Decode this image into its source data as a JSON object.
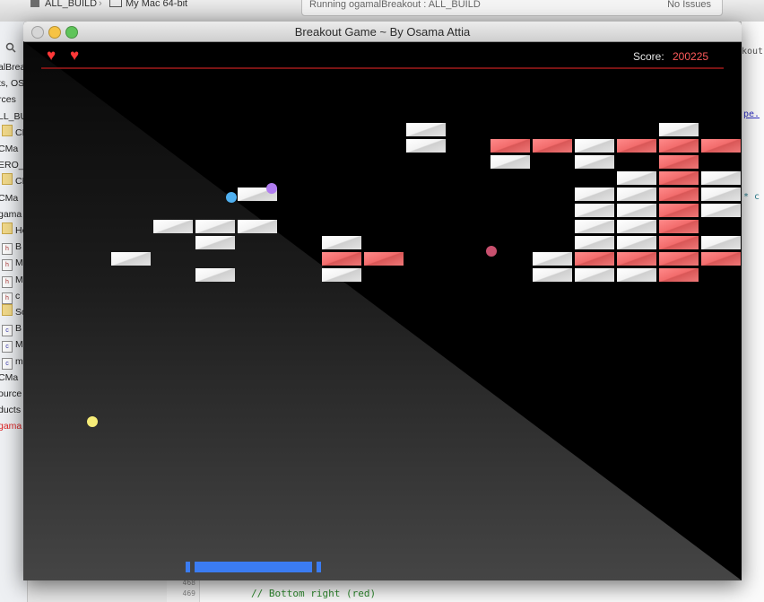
{
  "xcode": {
    "scheme": "ALL_BUILD",
    "destination": "My Mac 64-bit",
    "status": "Running ogamalBreakout : ALL_BUILD",
    "issues": "No Issues",
    "editor_fragments": [
      "koutz",
      "pe.",
      "* c"
    ],
    "navigator_rows": [
      {
        "text": "alBrea",
        "icon": ""
      },
      {
        "text": "ts, OS",
        "icon": ""
      },
      {
        "text": "rces",
        "icon": ""
      },
      {
        "text": "LL_BU",
        "icon": ""
      },
      {
        "text": "CMa",
        "icon": "folder"
      },
      {
        "text": "CMa",
        "icon": ""
      },
      {
        "text": "ERO_",
        "icon": ""
      },
      {
        "text": "CMa",
        "icon": "folder"
      },
      {
        "text": "CMa",
        "icon": ""
      },
      {
        "text": "gama",
        "icon": ""
      },
      {
        "text": "Hea",
        "icon": "folder"
      },
      {
        "text": "B",
        "icon": "h"
      },
      {
        "text": "M",
        "icon": "h"
      },
      {
        "text": "M",
        "icon": "h"
      },
      {
        "text": "c",
        "icon": "h"
      },
      {
        "text": "Sou",
        "icon": "folder"
      },
      {
        "text": "B",
        "icon": "src"
      },
      {
        "text": "M",
        "icon": "src"
      },
      {
        "text": "m",
        "icon": "src"
      },
      {
        "text": "CMa",
        "icon": ""
      },
      {
        "text": "ource",
        "icon": ""
      },
      {
        "text": "ducts",
        "icon": ""
      },
      {
        "text": "gama",
        "icon": "",
        "color": "#d22"
      }
    ],
    "line_numbers": [
      "468",
      "469"
    ],
    "code_comment": "// Bottom right (red)"
  },
  "window": {
    "title": "Breakout Game ~ By Osama Attia"
  },
  "hud": {
    "lives": 2,
    "heart_glyph": "♥",
    "score_label": "Score:",
    "score_value": "200225",
    "accent_color": "#ff3838"
  },
  "bricks": {
    "grid_origin": "top-left, 47px columns, 18px rows",
    "white": [
      [
        8,
        0
      ],
      [
        14,
        0
      ],
      [
        8,
        1
      ],
      [
        12,
        1
      ],
      [
        10,
        2
      ],
      [
        12,
        2
      ],
      [
        13,
        3
      ],
      [
        15,
        3
      ],
      [
        4,
        4
      ],
      [
        12,
        4
      ],
      [
        13,
        4
      ],
      [
        15,
        4
      ],
      [
        12,
        5
      ],
      [
        13,
        5
      ],
      [
        15,
        5
      ],
      [
        2,
        6
      ],
      [
        3,
        6
      ],
      [
        4,
        6
      ],
      [
        12,
        6
      ],
      [
        13,
        6
      ],
      [
        3,
        7
      ],
      [
        6,
        7
      ],
      [
        12,
        7
      ],
      [
        13,
        7
      ],
      [
        15,
        7
      ],
      [
        1,
        8
      ],
      [
        11,
        8
      ],
      [
        3,
        9
      ],
      [
        6,
        9
      ],
      [
        11,
        9
      ],
      [
        12,
        9
      ],
      [
        13,
        9
      ]
    ],
    "red": [
      [
        10,
        1
      ],
      [
        11,
        1
      ],
      [
        13,
        1
      ],
      [
        14,
        1
      ],
      [
        15,
        1
      ],
      [
        14,
        2
      ],
      [
        14,
        3
      ],
      [
        14,
        4
      ],
      [
        14,
        5
      ],
      [
        14,
        6
      ],
      [
        14,
        7
      ],
      [
        6,
        8
      ],
      [
        7,
        8
      ],
      [
        12,
        8
      ],
      [
        13,
        8
      ],
      [
        14,
        8
      ],
      [
        15,
        8
      ],
      [
        14,
        9
      ]
    ],
    "colors": {
      "white": "#f2f2f2",
      "red": "#f07070"
    }
  },
  "balls": [
    {
      "name": "blue-ball",
      "color": "#4fb0f0"
    },
    {
      "name": "purple-ball",
      "color": "#b07cf0"
    },
    {
      "name": "pink-ball",
      "color": "#c8506e"
    },
    {
      "name": "yellow-ball",
      "color": "#f6ec78"
    }
  ],
  "paddle": {
    "color": "#3b7cf2"
  }
}
